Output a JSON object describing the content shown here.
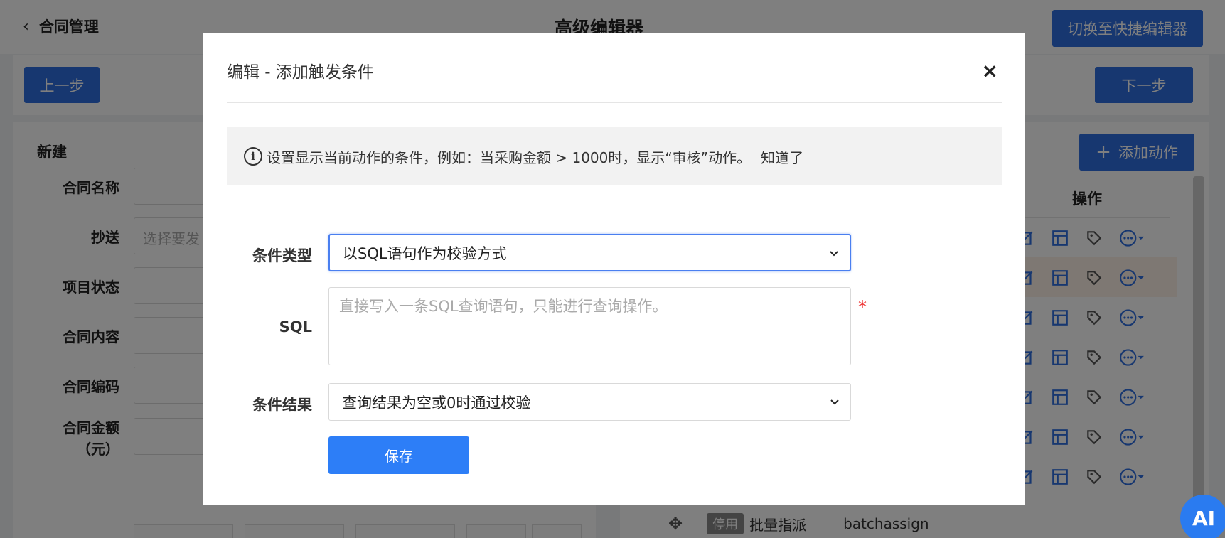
{
  "header": {
    "back_label": "合同管理",
    "page_title": "高级编辑器",
    "switch_label": "切换至快捷编辑器"
  },
  "steps": {
    "prev_label": "上一步",
    "next_label": "下一步"
  },
  "left_panel": {
    "title": "新建",
    "fields": [
      {
        "label": "合同名称",
        "placeholder": ""
      },
      {
        "label": "抄送",
        "placeholder": "选择要发"
      },
      {
        "label": "项目状态",
        "placeholder": ""
      },
      {
        "label": "合同内容",
        "placeholder": ""
      },
      {
        "label": "合同编码",
        "placeholder": ""
      },
      {
        "label": "合同金额",
        "label2": "（元）",
        "placeholder": ""
      }
    ]
  },
  "right_panel": {
    "add_action_label": "添加动作",
    "ops_header": "操作",
    "last_row": {
      "status": "停用",
      "name": "批量指派",
      "code": "batchassign"
    }
  },
  "ai_label": "AI",
  "modal": {
    "title": "编辑 - 添加触发条件",
    "close_symbol": "×",
    "info_text": "设置显示当前动作的条件，例如：当采购金额 > 1000时，显示“审核”动作。",
    "info_dismiss": "知道了",
    "condition_type_label": "条件类型",
    "condition_type_value": "以SQL语句作为校验方式",
    "sql_label": "SQL",
    "sql_placeholder": "直接写入一条SQL查询语句，只能进行查询操作。",
    "sql_required": "*",
    "condition_result_label": "条件结果",
    "condition_result_value": "查询结果为空或0时通过校验",
    "save_label": "保存"
  },
  "colors": {
    "primary": "#2f6fe0",
    "save": "#2d7ef7",
    "focus": "#4a7ff0",
    "required": "#e33333"
  },
  "icons": [
    "back-chevron-icon",
    "plus-icon",
    "edit-icon",
    "layout-icon",
    "tag-icon",
    "more-icon",
    "info-icon",
    "close-icon",
    "chevron-down-icon",
    "move-icon"
  ]
}
